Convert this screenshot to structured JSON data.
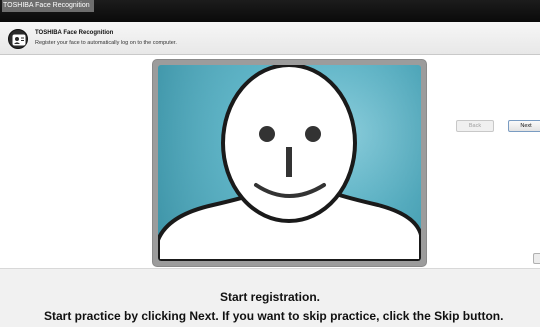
{
  "window": {
    "title": "TOSHIBA Face Recognition"
  },
  "header": {
    "icon": "face-recognition-icon",
    "title": "TOSHIBA Face Recognition",
    "subtitle": "Register your face to automatically log on to the computer."
  },
  "camera": {
    "placeholder_icon": "face-outline-icon"
  },
  "buttons": {
    "back_label": "Back",
    "next_label": "Next",
    "back_enabled": false,
    "next_enabled": true
  },
  "instructions": {
    "line1": "Start registration.",
    "line2": "Start practice by clicking Next. If you want to skip practice, click the Skip button."
  },
  "colors": {
    "titlebar": "#0a0a0a",
    "camera_background": "#5bb3c6",
    "frame": "#9c9c9c",
    "next_border": "#7a9cc2"
  }
}
